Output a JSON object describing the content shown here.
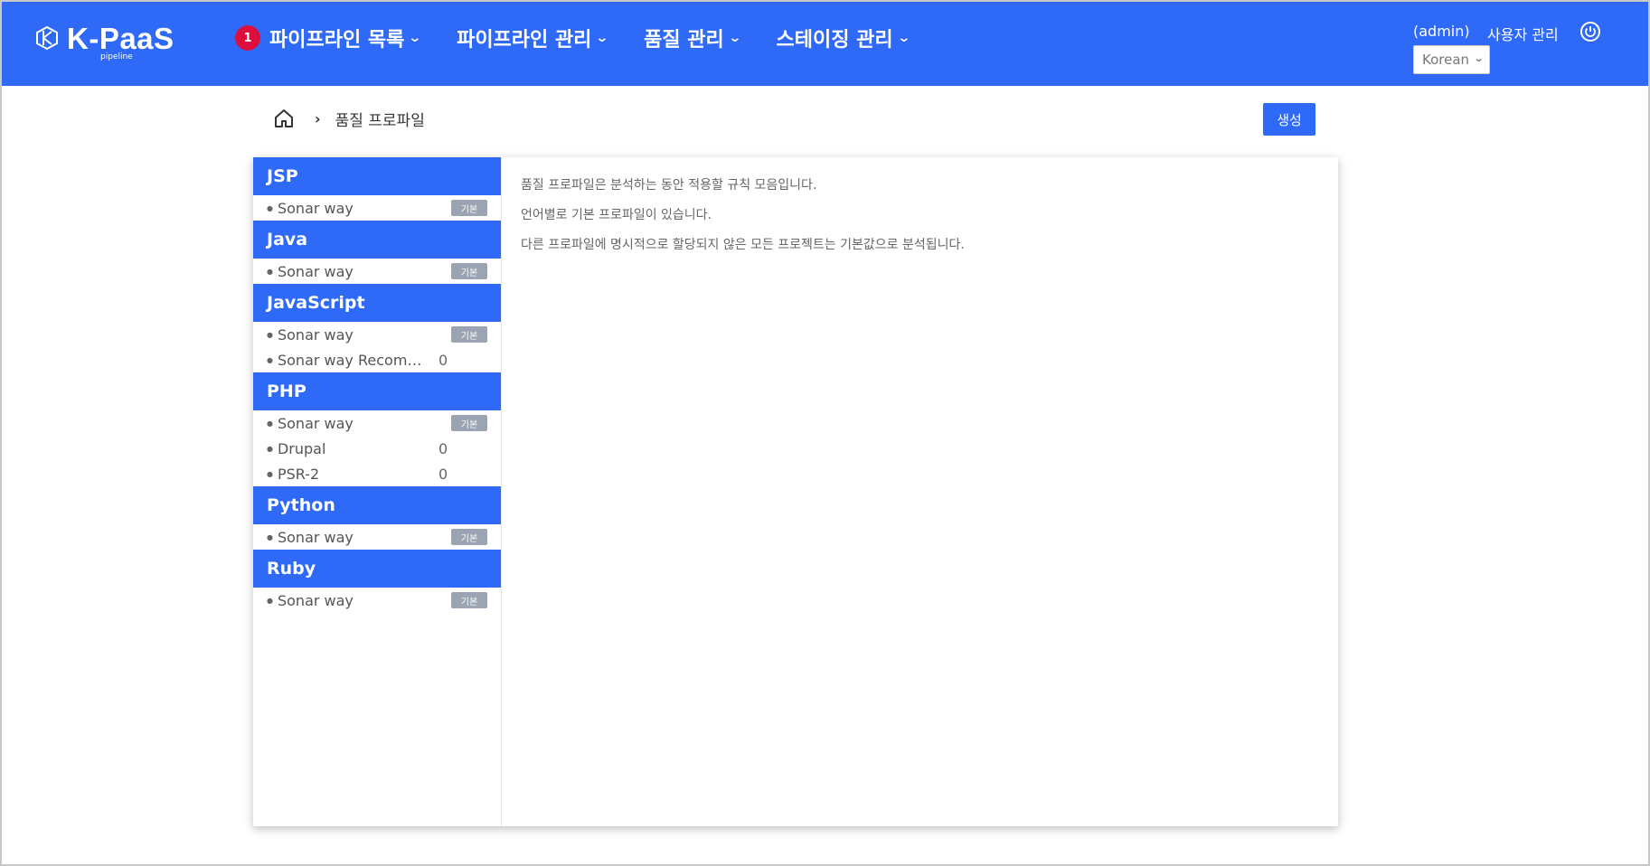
{
  "header": {
    "logo_text": "K-PaaS",
    "logo_sub": "pipeline",
    "nav": [
      {
        "label": "파이프라인 목록",
        "badge": "1"
      },
      {
        "label": "파이프라인 관리"
      },
      {
        "label": "품질 관리"
      },
      {
        "label": "스테이징 관리"
      }
    ],
    "user": "(admin)",
    "user_manage": "사용자 관리",
    "language": "Korean"
  },
  "breadcrumb": {
    "current": "품질 프로파일"
  },
  "create_button": "생성",
  "default_label": "기본",
  "groups": [
    {
      "language": "JSP",
      "profiles": [
        {
          "name": "Sonar way",
          "default": true
        }
      ]
    },
    {
      "language": "Java",
      "profiles": [
        {
          "name": "Sonar way",
          "default": true
        }
      ]
    },
    {
      "language": "JavaScript",
      "profiles": [
        {
          "name": "Sonar way",
          "default": true
        },
        {
          "name": "Sonar way Recommended",
          "count": "0"
        }
      ]
    },
    {
      "language": "PHP",
      "profiles": [
        {
          "name": "Sonar way",
          "default": true
        },
        {
          "name": "Drupal",
          "count": "0"
        },
        {
          "name": "PSR-2",
          "count": "0"
        }
      ]
    },
    {
      "language": "Python",
      "profiles": [
        {
          "name": "Sonar way",
          "default": true
        }
      ]
    },
    {
      "language": "Ruby",
      "profiles": [
        {
          "name": "Sonar way",
          "default": true
        }
      ]
    }
  ],
  "description": [
    "품질 프로파일은 분석하는 동안 적용할 규칙 모음입니다.",
    "언어별로 기본 프로파일이 있습니다.",
    "다른 프로파일에 명시적으로 할당되지 않은 모든 프로젝트는 기본값으로 분석됩니다."
  ],
  "colors": {
    "primary": "#2e6af7",
    "badge_red": "#dc0f3c",
    "default_badge": "#9aa4b2"
  }
}
